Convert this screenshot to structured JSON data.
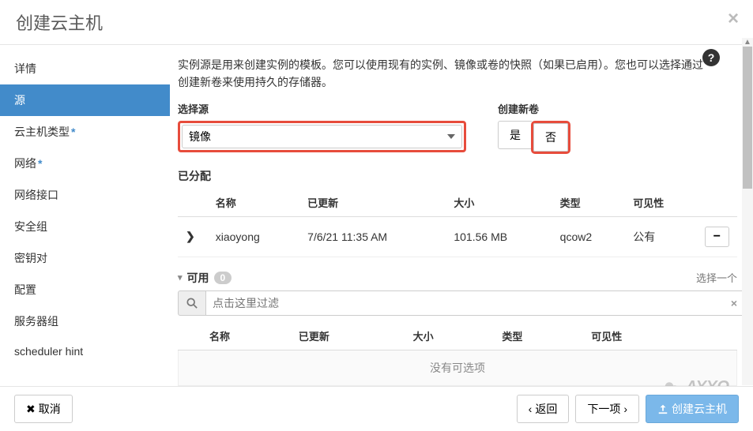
{
  "modal": {
    "title": "创建云主机"
  },
  "sidebar": {
    "items": [
      {
        "label": "详情",
        "required": false
      },
      {
        "label": "源",
        "required": false,
        "active": true
      },
      {
        "label": "云主机类型",
        "required": true
      },
      {
        "label": "网络",
        "required": true
      },
      {
        "label": "网络接口",
        "required": false
      },
      {
        "label": "安全组",
        "required": false
      },
      {
        "label": "密钥对",
        "required": false
      },
      {
        "label": "配置",
        "required": false
      },
      {
        "label": "服务器组",
        "required": false
      },
      {
        "label": "scheduler hint",
        "required": false
      }
    ]
  },
  "main": {
    "description": "实例源是用来创建实例的模板。您可以使用现有的实例、镜像或卷的快照（如果已启用）。您也可以选择通过创建新卷来使用持久的存储器。",
    "select_source_label": "选择源",
    "select_source_value": "镜像",
    "create_volume_label": "创建新卷",
    "yes": "是",
    "no": "否",
    "allocated_title": "已分配",
    "allocated_headers": {
      "name": "名称",
      "updated": "已更新",
      "size": "大小",
      "type": "类型",
      "visibility": "可见性"
    },
    "allocated_row": {
      "name": "xiaoyong",
      "updated": "7/6/21 11:35 AM",
      "size": "101.56 MB",
      "type": "qcow2",
      "visibility": "公有"
    },
    "remove_btn": "−",
    "available_title": "可用",
    "available_count": "0",
    "select_one": "选择一个",
    "filter_placeholder": "点击这里过滤",
    "available_headers": {
      "name": "名称",
      "updated": "已更新",
      "size": "大小",
      "type": "类型",
      "visibility": "可见性"
    },
    "empty_text": "没有可选项"
  },
  "footer": {
    "cancel": "取消",
    "back": "返回",
    "next": "下一项",
    "launch": "创建云主机"
  },
  "watermark": "AYYO"
}
